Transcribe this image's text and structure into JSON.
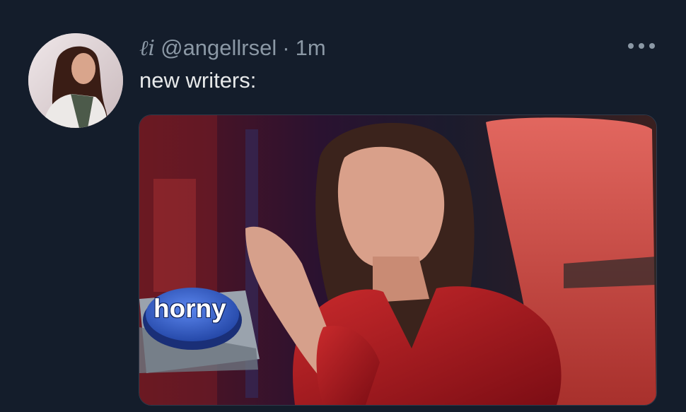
{
  "tweet": {
    "display_name": "ℓi",
    "handle": "@angellrsel",
    "separator": "·",
    "timestamp": "1m",
    "text": "new writers:"
  },
  "media": {
    "button_label": "horny"
  },
  "icons": {
    "more": "more-horizontal-icon"
  },
  "colors": {
    "background": "#141d2b",
    "muted_text": "#8b98a5",
    "primary_text": "#e7e9ea",
    "jacket_red": "#a8161c",
    "button_blue": "#2b57c9"
  }
}
